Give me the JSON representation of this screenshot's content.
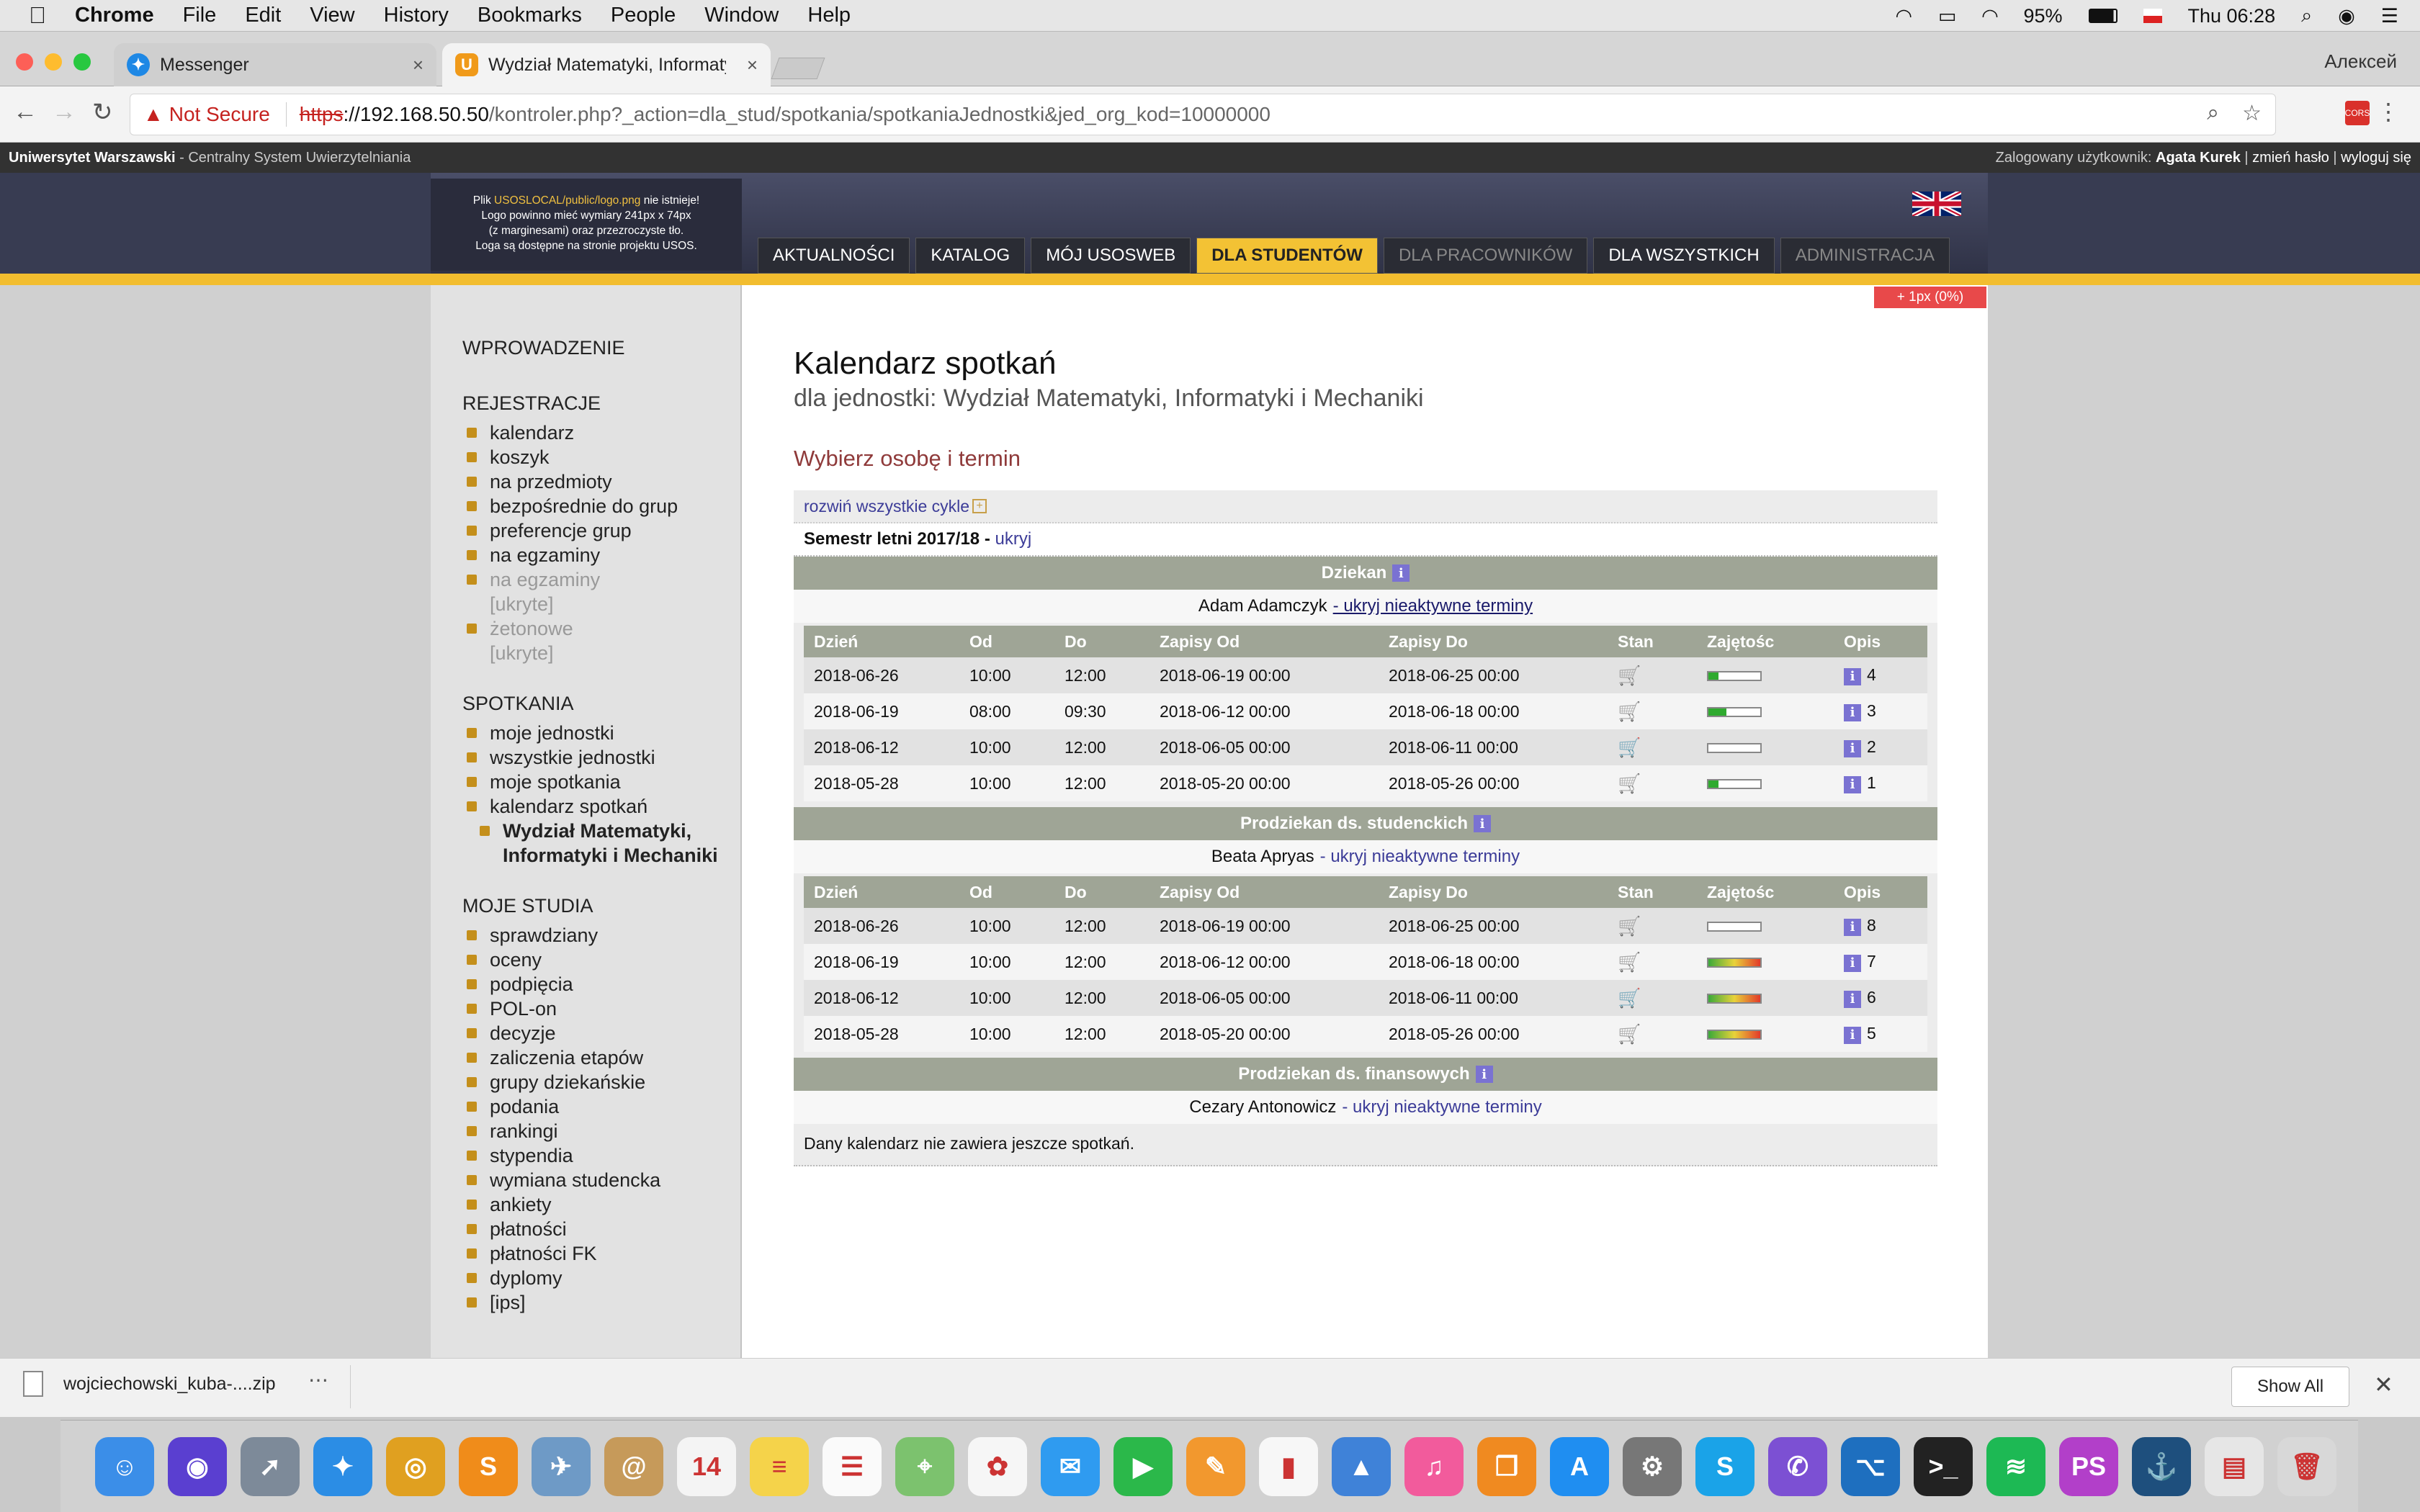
{
  "macos": {
    "app": "Chrome",
    "menus": [
      "File",
      "Edit",
      "View",
      "History",
      "Bookmarks",
      "People",
      "Window",
      "Help"
    ],
    "battery": "95%",
    "clock": "Thu 06:28"
  },
  "browser": {
    "tabs": [
      {
        "title": "Messenger",
        "icon_color": "#1e88e5"
      },
      {
        "title": "Wydział Matematyki, Informaty",
        "icon_color": "#f09a1a"
      }
    ],
    "profile": "Алексей",
    "not_secure": "Not Secure",
    "url_scheme": "https",
    "url_host": "://192.168.50.50",
    "url_path": "/kontroler.php?_action=dla_stud/spotkania/spotkaniaJednostki&jed_org_kod=10000000"
  },
  "usos_top": {
    "left_bold": "Uniwersytet Warszawski",
    "left_rest": " - Centralny System Uwierzytelniania",
    "logged_label": "Zalogowany użytkownik:",
    "user": "Agata Kurek",
    "change_pw": "zmień hasło",
    "logout": "wyloguj się"
  },
  "logo_notice": {
    "pre": "Plik ",
    "file": "USOSLOCAL/public/logo.png",
    "post": " nie istnieje!",
    "line2": "Logo powinno mieć wymiary 241px x 74px",
    "line3": "(z marginesami) oraz przezroczyste tło.",
    "line4": "Loga są dostępne na stronie projektu USOS."
  },
  "nav": [
    {
      "label": "AKTUALNOŚCI",
      "state": "normal"
    },
    {
      "label": "KATALOG",
      "state": "normal"
    },
    {
      "label": "MÓJ USOSWEB",
      "state": "normal"
    },
    {
      "label": "DLA STUDENTÓW",
      "state": "active"
    },
    {
      "label": "DLA PRACOWNIKÓW",
      "state": "dim"
    },
    {
      "label": "DLA WSZYSTKICH",
      "state": "normal"
    },
    {
      "label": "ADMINISTRACJA",
      "state": "dim"
    }
  ],
  "dev_tag": "+ 1px (0%)",
  "sidebar": {
    "intro": "WPROWADZENIE",
    "reg": "REJESTRACJE",
    "reg_items": [
      "kalendarz",
      "koszyk",
      "na przedmioty",
      "bezpośrednie do grup",
      "preferencje grup",
      "na egzaminy"
    ],
    "reg_dim1": "na egzaminy",
    "hidden1": "[ukryte]",
    "reg_dim2": "żetonowe",
    "hidden2": "[ukryte]",
    "meet": "SPOTKANIA",
    "meet_items": [
      "moje jednostki",
      "wszystkie jednostki",
      "moje spotkania",
      "kalendarz spotkań"
    ],
    "meet_sub": "Wydział Matematyki, Informatyki i Mechaniki",
    "studies": "MOJE STUDIA",
    "studies_items": [
      "sprawdziany",
      "oceny",
      "podpięcia",
      "POL-on",
      "decyzje",
      "zaliczenia etapów",
      "grupy dziekańskie",
      "podania",
      "rankingi",
      "stypendia",
      "wymiana studencka",
      "ankiety",
      "płatności",
      "płatności FK",
      "dyplomy",
      "[ips]"
    ]
  },
  "main": {
    "title": "Kalendarz spotkań",
    "subtitle": "dla jednostki: Wydział Matematyki, Informatyki i Mechaniki",
    "choose": "Wybierz osobę i termin",
    "expand_all": "rozwiń wszystkie cykle",
    "semester": "Semestr letni 2017/18 -",
    "hide": "ukryj",
    "columns": [
      "Dzień",
      "Od",
      "Do",
      "Zapisy Od",
      "Zapisy Do",
      "Stan",
      "Zajętośc",
      "Opis"
    ],
    "sections": [
      {
        "title": "Dziekan",
        "person": "Adam Adamczyk",
        "link": "- ukryj nieaktywne terminy",
        "rows": [
          {
            "day": "2018-06-26",
            "from": "10:00",
            "to": "12:00",
            "reg_from": "2018-06-19 00:00",
            "reg_to": "2018-06-25 00:00",
            "state": "closed",
            "fill": 0.2,
            "fill_color": "#2faa2f",
            "desc": "4"
          },
          {
            "day": "2018-06-19",
            "from": "08:00",
            "to": "09:30",
            "reg_from": "2018-06-12 00:00",
            "reg_to": "2018-06-18 00:00",
            "state": "closed",
            "fill": 0.35,
            "fill_color": "#2faa2f",
            "desc": "3"
          },
          {
            "day": "2018-06-12",
            "from": "10:00",
            "to": "12:00",
            "reg_from": "2018-06-05 00:00",
            "reg_to": "2018-06-11 00:00",
            "state": "open",
            "fill": 0,
            "fill_color": "#2faa2f",
            "desc": "2"
          },
          {
            "day": "2018-05-28",
            "from": "10:00",
            "to": "12:00",
            "reg_from": "2018-05-20 00:00",
            "reg_to": "2018-05-26 00:00",
            "state": "closed",
            "fill": 0.2,
            "fill_color": "#2faa2f",
            "desc": "1"
          }
        ]
      },
      {
        "title": "Prodziekan ds. studenckich",
        "person": "Beata Apryas",
        "link": "- ukryj nieaktywne terminy",
        "rows": [
          {
            "day": "2018-06-26",
            "from": "10:00",
            "to": "12:00",
            "reg_from": "2018-06-19 00:00",
            "reg_to": "2018-06-25 00:00",
            "state": "closed",
            "fill": 0,
            "fill_color": "#2faa2f",
            "desc": "8"
          },
          {
            "day": "2018-06-19",
            "from": "10:00",
            "to": "12:00",
            "reg_from": "2018-06-12 00:00",
            "reg_to": "2018-06-18 00:00",
            "state": "closed",
            "fill": 1,
            "fill_color": "gradient",
            "desc": "7"
          },
          {
            "day": "2018-06-12",
            "from": "10:00",
            "to": "12:00",
            "reg_from": "2018-06-05 00:00",
            "reg_to": "2018-06-11 00:00",
            "state": "open",
            "fill": 1,
            "fill_color": "gradient",
            "desc": "6"
          },
          {
            "day": "2018-05-28",
            "from": "10:00",
            "to": "12:00",
            "reg_from": "2018-05-20 00:00",
            "reg_to": "2018-05-26 00:00",
            "state": "closed",
            "fill": 1,
            "fill_color": "gradient",
            "desc": "5"
          }
        ]
      },
      {
        "title": "Prodziekan ds. finansowych",
        "person": "Cezary Antonowicz",
        "link": "- ukryj nieaktywne terminy",
        "empty": "Dany kalendarz nie zawiera jeszcze spotkań.",
        "rows": []
      }
    ]
  },
  "download": {
    "file": "wojciechowski_kuba-....zip",
    "show_all": "Show All"
  },
  "dock_apps": [
    {
      "name": "finder-icon",
      "color": "#3b8ee8",
      "glyph": "☺"
    },
    {
      "name": "siri-icon",
      "color": "#5a3fd0",
      "glyph": "◉"
    },
    {
      "name": "launchpad-icon",
      "color": "#7d8a99",
      "glyph": "➚"
    },
    {
      "name": "safari-icon",
      "color": "#2b8de5",
      "glyph": "✦"
    },
    {
      "name": "chrome-icon",
      "color": "#e0a020",
      "glyph": "◎"
    },
    {
      "name": "sublime-icon",
      "color": "#f08c1a",
      "glyph": "S"
    },
    {
      "name": "preview-icon",
      "color": "#6e9ac6",
      "glyph": "✈"
    },
    {
      "name": "contacts-icon",
      "color": "#c69a5a",
      "glyph": "@"
    },
    {
      "name": "calendar-icon",
      "color": "#f4f4f4",
      "glyph": "14"
    },
    {
      "name": "notes-icon",
      "color": "#f5d34a",
      "glyph": "≡"
    },
    {
      "name": "reminders-icon",
      "color": "#fafafa",
      "glyph": "☰"
    },
    {
      "name": "maps-icon",
      "color": "#7cc26e",
      "glyph": "⌖"
    },
    {
      "name": "photos-icon",
      "color": "#f6f6f6",
      "glyph": "✿"
    },
    {
      "name": "messages-icon",
      "color": "#2f9bf0",
      "glyph": "✉"
    },
    {
      "name": "facetime-icon",
      "color": "#2bb84a",
      "glyph": "▶"
    },
    {
      "name": "pages-icon",
      "color": "#f2982e",
      "glyph": "✎"
    },
    {
      "name": "numbers-icon",
      "color": "#f7f7f7",
      "glyph": "▮"
    },
    {
      "name": "keynote-icon",
      "color": "#3f82d8",
      "glyph": "▲"
    },
    {
      "name": "itunes-icon",
      "color": "#f25b9c",
      "glyph": "♫"
    },
    {
      "name": "ibooks-icon",
      "color": "#f08a20",
      "glyph": "❒"
    },
    {
      "name": "appstore-icon",
      "color": "#1f8ef1",
      "glyph": "A"
    },
    {
      "name": "system-preferences-icon",
      "color": "#777",
      "glyph": "⚙"
    },
    {
      "name": "skype-icon",
      "color": "#1aa3e8",
      "glyph": "S"
    },
    {
      "name": "viber-icon",
      "color": "#7c50d3",
      "glyph": "✆"
    },
    {
      "name": "vscode-icon",
      "color": "#1e6fbf",
      "glyph": "⌥"
    },
    {
      "name": "terminal-icon",
      "color": "#222",
      "glyph": ">_"
    },
    {
      "name": "spotify-icon",
      "color": "#1db954",
      "glyph": "≋"
    },
    {
      "name": "phpstorm-icon",
      "color": "#b23fc9",
      "glyph": "PS"
    },
    {
      "name": "mysql-workbench-icon",
      "color": "#1e4f7d",
      "glyph": "⚓"
    },
    {
      "name": "archive-icon",
      "color": "#e6e6e6",
      "glyph": "▤"
    },
    {
      "name": "trash-icon",
      "color": "#d8d8d8",
      "glyph": "🗑"
    }
  ]
}
